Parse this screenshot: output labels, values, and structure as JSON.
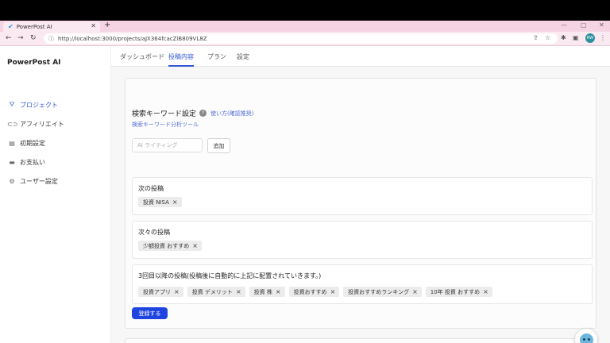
{
  "browser": {
    "tab_title": "PowerPost AI",
    "new_tab": "+",
    "url": "http://localhost:3000/projects/aJX364fcacZiB809VL8Z",
    "avatar_initials": "RW"
  },
  "sidebar": {
    "brand": "PowerPost AI",
    "items": [
      {
        "label": "プロジェクト",
        "icon": "project-icon",
        "active": true
      },
      {
        "label": "アフィリエイト",
        "icon": "affiliate-icon",
        "active": false
      },
      {
        "label": "初期設定",
        "icon": "briefcase-icon",
        "active": false
      },
      {
        "label": "お支払い",
        "icon": "card-icon",
        "active": false
      },
      {
        "label": "ユーザー設定",
        "icon": "gear-icon",
        "active": false
      }
    ]
  },
  "topnav": {
    "tabs": [
      {
        "label": "ダッシュボード",
        "active": false
      },
      {
        "label": "投稿内容",
        "active": true
      },
      {
        "label": "プラン",
        "active": false
      },
      {
        "label": "設定",
        "active": false
      }
    ]
  },
  "keyword_settings": {
    "title": "検索キーワード設定",
    "help_glyph": "?",
    "howto_link": "使い方(確認推奨)",
    "tool_link": "検索キーワード分析ツール",
    "input_placeholder": "AI ライティング",
    "add_button": "追加"
  },
  "panels": {
    "next": {
      "title": "次の投稿",
      "chips": [
        "投資 NISA"
      ]
    },
    "after_next": {
      "title": "次々の投稿",
      "chips": [
        "少額投資 おすすめ"
      ]
    },
    "third_onward": {
      "title": "3回目以降の投稿(投稿後に自動的に上記に配置されていきます。)",
      "chips": [
        "投資アプリ",
        "投資 デメリット",
        "投資 株",
        "投資おすすめ",
        "投資おすすめランキング",
        "10年 投資 おすすめ"
      ]
    }
  },
  "chip_remove_glyph": "×",
  "submit_button": "登録する",
  "colors": {
    "accent": "#3457d5",
    "primary_button": "#1f45e0",
    "browser_chrome": "#f5d3e3"
  }
}
